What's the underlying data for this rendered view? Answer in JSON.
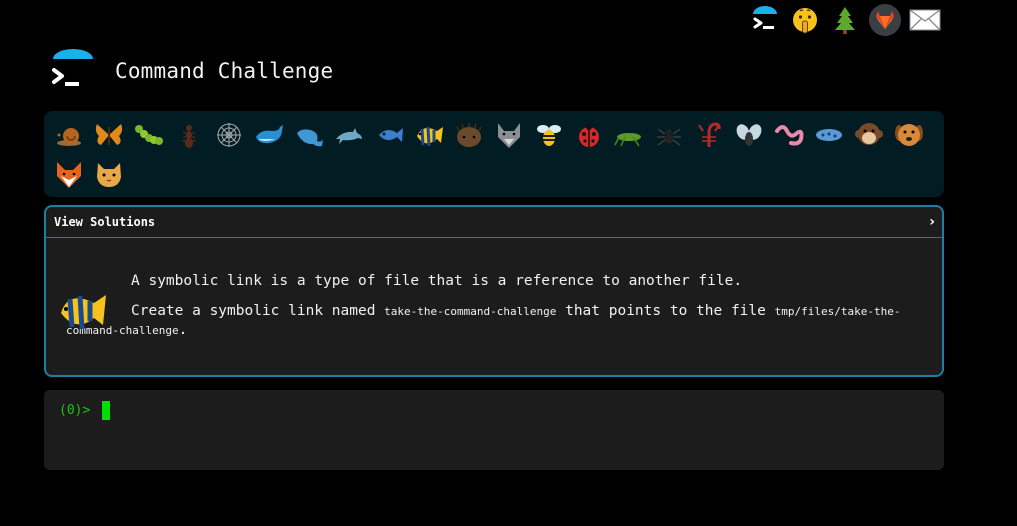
{
  "header": {
    "title": "Command Challenge"
  },
  "top_nav": [
    {
      "name": "home",
      "icon": "terminal-logo-icon"
    },
    {
      "name": "hint",
      "icon": "shushing-face-icon"
    },
    {
      "name": "tree",
      "icon": "evergreen-tree-icon"
    },
    {
      "name": "gitlab",
      "icon": "gitlab-fox-icon"
    },
    {
      "name": "mail",
      "icon": "envelope-icon"
    }
  ],
  "challenges": [
    "snail",
    "butterfly",
    "caterpillar",
    "ant",
    "spider-web",
    "whale",
    "whale-2",
    "dolphin",
    "fish",
    "tropical-fish",
    "hedgehog",
    "wolf",
    "bee",
    "ladybug",
    "cricket",
    "spider",
    "scorpion",
    "fly",
    "worm",
    "microbe",
    "monkey",
    "dog",
    "fox",
    "cat"
  ],
  "active_challenge": "tropical-fish",
  "panel": {
    "header_label": "View Solutions",
    "chevron": "›",
    "line1": "A symbolic link is a type of file that is a reference to another file.",
    "line2_prefix": "Create a symbolic link named ",
    "link_name": "take-the-command-challenge",
    "line2_middle": " that points to the file ",
    "target_path": "tmp/files/take-the-command-challenge",
    "line2_suffix": "."
  },
  "terminal": {
    "prompt": "(0)>"
  },
  "colors": {
    "accent": "#1d7fa3",
    "prompt": "#19c319",
    "cursor": "#00e000",
    "strip_bg": "#021c24",
    "panel_bg": "#1c1c1c"
  }
}
